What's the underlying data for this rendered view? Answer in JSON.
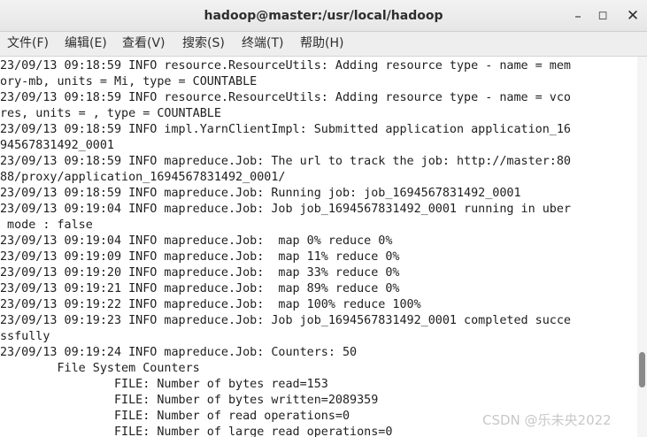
{
  "window": {
    "title": "hadoop@master:/usr/local/hadoop",
    "min_glyph": "–",
    "max_glyph": "◻",
    "close_glyph": "✕"
  },
  "menu": [
    {
      "label": "文件(F)"
    },
    {
      "label": "编辑(E)"
    },
    {
      "label": "查看(V)"
    },
    {
      "label": "搜索(S)"
    },
    {
      "label": "终端(T)"
    },
    {
      "label": "帮助(H)"
    }
  ],
  "terminal_lines": [
    "23/09/13 09:18:59 INFO resource.ResourceUtils: Adding resource type - name = mem",
    "ory-mb, units = Mi, type = COUNTABLE",
    "23/09/13 09:18:59 INFO resource.ResourceUtils: Adding resource type - name = vco",
    "res, units = , type = COUNTABLE",
    "23/09/13 09:18:59 INFO impl.YarnClientImpl: Submitted application application_16",
    "94567831492_0001",
    "23/09/13 09:18:59 INFO mapreduce.Job: The url to track the job: http://master:80",
    "88/proxy/application_1694567831492_0001/",
    "23/09/13 09:18:59 INFO mapreduce.Job: Running job: job_1694567831492_0001",
    "23/09/13 09:19:04 INFO mapreduce.Job: Job job_1694567831492_0001 running in uber",
    " mode : false",
    "23/09/13 09:19:04 INFO mapreduce.Job:  map 0% reduce 0%",
    "23/09/13 09:19:09 INFO mapreduce.Job:  map 11% reduce 0%",
    "23/09/13 09:19:20 INFO mapreduce.Job:  map 33% reduce 0%",
    "23/09/13 09:19:21 INFO mapreduce.Job:  map 89% reduce 0%",
    "23/09/13 09:19:22 INFO mapreduce.Job:  map 100% reduce 100%",
    "23/09/13 09:19:23 INFO mapreduce.Job: Job job_1694567831492_0001 completed succe",
    "ssfully",
    "23/09/13 09:19:24 INFO mapreduce.Job: Counters: 50",
    "        File System Counters",
    "                FILE: Number of bytes read=153",
    "                FILE: Number of bytes written=2089359",
    "                FILE: Number of read operations=0",
    "                FILE: Number of large read operations=0"
  ],
  "watermark": "CSDN @乐未央2022",
  "colors": {
    "terminal_bg": "#ffffff",
    "terminal_fg": "#1e1e1e",
    "titlebar_bg": "#ececec",
    "menubar_bg": "#eeeeee"
  }
}
